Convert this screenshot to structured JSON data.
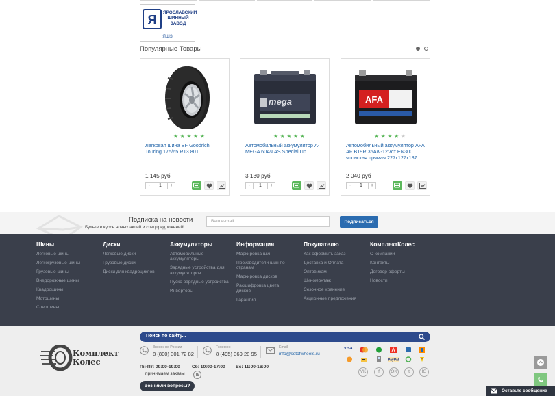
{
  "brand": {
    "name": "ЯРОСЛАВСКИЙ ШИННЫЙ ЗАВОД",
    "caption": "ЯШЗ",
    "logo_letter": "Я"
  },
  "popular": {
    "title": "Популярные Товары",
    "products": [
      {
        "title": "Легковая шина BF Goodrich Touring 175/65 R13 80T",
        "price": "1 145 руб",
        "qty": "1",
        "rating": 5,
        "image": "tire-image"
      },
      {
        "title": "Автомобильный аккумулятор A-MEGA 60Ач AS Special Пр",
        "price": "3 130 руб",
        "qty": "1",
        "rating": 5,
        "image": "battery-amega-image"
      },
      {
        "title": "Автомобильный аккумулятор AFA AF B19R 35А/ч-12Vст EN300 японская прямая 227x127x187",
        "price": "2 040 руб",
        "qty": "1",
        "rating": 4,
        "image": "battery-afa-image"
      }
    ],
    "qty_minus": "-",
    "qty_plus": "+"
  },
  "subscribe": {
    "title": "Подписка на новости",
    "text": "Будьте в курсе новых акций и спецпредложений!",
    "placeholder": "Ваш e-mail",
    "button": "Подписаться"
  },
  "footer_menu": [
    {
      "title": "Шины",
      "links": [
        "Легковые шины",
        "Легкогрузовые шины",
        "Грузовые шины",
        "Внедорожные шины",
        "Квадрошины",
        "Мотошины",
        "Спецшины"
      ]
    },
    {
      "title": "Диски",
      "links": [
        "Легковые диски",
        "Грузовые диски",
        "Диски для квадроциклов"
      ]
    },
    {
      "title": "Аккумуляторы",
      "links": [
        "Автомобильные аккумуляторы",
        "Зарядные устройства для аккумуляторов",
        "Пуско-зарядные устройства",
        "Инверторы"
      ]
    },
    {
      "title": "Информация",
      "links": [
        "Маркировка шин",
        "Производители шин по странам",
        "Маркировка дисков",
        "Расшифровка цвета дисков",
        "Гарантия"
      ]
    },
    {
      "title": "Покупателю",
      "links": [
        "Как оформить заказ",
        "Доставка и Оплата",
        "Оптовикам",
        "Шиномонтаж",
        "Сезонное хранение",
        "Акционные предложения"
      ]
    },
    {
      "title": "КомплектКолес",
      "links": [
        "О компании",
        "Контакты",
        "Договор оферты",
        "Новости"
      ]
    }
  ],
  "bottom": {
    "logo_line1": "Комплект",
    "logo_line2": "Колес",
    "search_placeholder": "Поиск по сайту...",
    "contacts": [
      {
        "label": "Звонок по России",
        "value": "8 (800) 301 72 82",
        "icon": "phone-icon"
      },
      {
        "label": "Телефон",
        "value": "8 (495) 369 28 95",
        "icon": "phone-icon"
      },
      {
        "label": "Email",
        "value": "info@setofwheels.ru",
        "icon": "mail-icon"
      }
    ],
    "hours": [
      "Пн-Пт: 09:00-19:00",
      "Сб: 10:00-17:00",
      "Вс: 11:00-16:00"
    ],
    "hours_note": "принимаем заказы",
    "question_button": "Возникли вопросы?",
    "payments": [
      "VISA",
      "MC",
      "Сбербанк",
      "Альфа",
      "QIWI",
      "WebMoney",
      "Яндекс",
      "PayPal",
      "Евросеть",
      "Связной"
    ],
    "socials": [
      "VK",
      "f",
      "OK",
      "t",
      "IG"
    ],
    "chat": "Оставьте сообщение"
  },
  "colors": {
    "accent": "#2b6cb0",
    "green": "#5cb85c",
    "footer_dark": "#3a3f4b",
    "link": "#2164a8"
  }
}
